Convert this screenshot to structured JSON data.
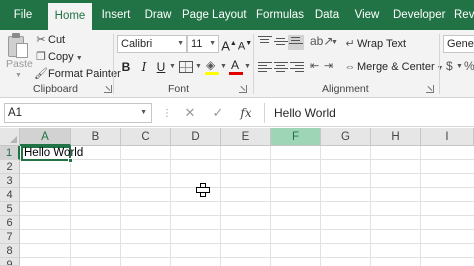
{
  "tabs": [
    {
      "label": "File",
      "active": false
    },
    {
      "label": "Home",
      "active": true
    },
    {
      "label": "Insert",
      "active": false
    },
    {
      "label": "Draw",
      "active": false
    },
    {
      "label": "Page Layout",
      "active": false
    },
    {
      "label": "Formulas",
      "active": false
    },
    {
      "label": "Data",
      "active": false
    },
    {
      "label": "View",
      "active": false
    },
    {
      "label": "Developer",
      "active": false
    },
    {
      "label": "Rev",
      "active": false
    }
  ],
  "ribbon": {
    "clipboard": {
      "paste_label": "Paste",
      "cut_label": "Cut",
      "copy_label": "Copy",
      "format_painter_label": "Format Painter",
      "group_label": "Clipboard"
    },
    "font": {
      "font_name": "Calibri",
      "font_size": "11",
      "grow_label": "A",
      "shrink_label": "A",
      "bold_label": "B",
      "italic_label": "I",
      "underline_label": "U",
      "font_color_label": "A",
      "group_label": "Font"
    },
    "alignment": {
      "wrap_text_label": "Wrap Text",
      "merge_center_label": "Merge & Center",
      "group_label": "Alignment"
    },
    "number": {
      "format_value": "Genera"
    }
  },
  "formula_bar": {
    "name_box": "A1",
    "cancel_glyph": "✕",
    "enter_glyph": "✓",
    "fx_label": "fx",
    "content": "Hello World"
  },
  "grid": {
    "columns": [
      "A",
      "B",
      "C",
      "D",
      "E",
      "F",
      "G",
      "H",
      "I"
    ],
    "rows": [
      "1",
      "2",
      "3",
      "4",
      "5",
      "6",
      "7",
      "8",
      "9"
    ],
    "cells": {
      "A1": "Hello World"
    },
    "selected_cell": "A1",
    "highlighted_column": "F"
  },
  "colors": {
    "accent": "#217346",
    "ribbon_bg": "#f3f3f3",
    "highlight_column": "#9fd5b7"
  }
}
